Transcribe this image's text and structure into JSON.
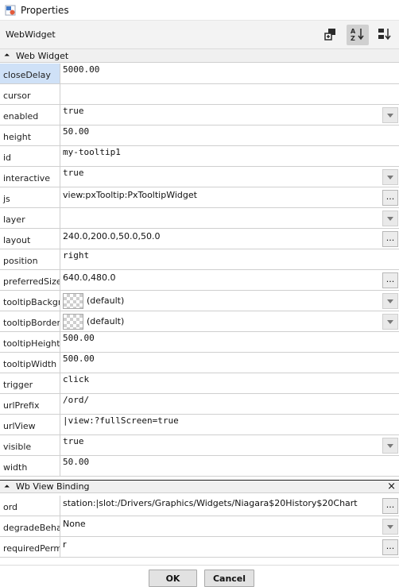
{
  "window": {
    "title": "Properties"
  },
  "toolbar": {
    "type_label": "WebWidget",
    "tools": [
      "add-slot-icon",
      "sort-az-icon",
      "sort-order-icon"
    ]
  },
  "sections": [
    {
      "title": "Web Widget",
      "rows": [
        {
          "name": "closeDelay",
          "value": "5000.00",
          "font": "mono",
          "control": "none",
          "selected": true
        },
        {
          "name": "cursor",
          "value": "",
          "font": "mono",
          "control": "none"
        },
        {
          "name": "enabled",
          "value": "true",
          "font": "mono",
          "control": "dropdown"
        },
        {
          "name": "height",
          "value": "50.00",
          "font": "mono",
          "control": "none"
        },
        {
          "name": "id",
          "value": "my-tooltip1",
          "font": "mono",
          "control": "none"
        },
        {
          "name": "interactive",
          "value": "true",
          "font": "mono",
          "control": "dropdown"
        },
        {
          "name": "js",
          "value": "view:pxTooltip:PxTooltipWidget",
          "font": "sans",
          "control": "ellipsis"
        },
        {
          "name": "layer",
          "value": "",
          "font": "mono",
          "control": "dropdown"
        },
        {
          "name": "layout",
          "value": "240.0,200.0,50.0,50.0",
          "font": "sans",
          "control": "ellipsis"
        },
        {
          "name": "position",
          "value": "right",
          "font": "mono",
          "control": "none"
        },
        {
          "name": "preferredSize",
          "value": "640.0,480.0",
          "font": "sans",
          "control": "ellipsis"
        },
        {
          "name": "tooltipBackground",
          "value": "(default)",
          "font": "sans",
          "control": "dropdown",
          "swatch": true
        },
        {
          "name": "tooltipBorder",
          "value": "(default)",
          "font": "sans",
          "control": "dropdown",
          "swatch": true
        },
        {
          "name": "tooltipHeight",
          "value": "500.00",
          "font": "mono",
          "control": "none"
        },
        {
          "name": "tooltipWidth",
          "value": "500.00",
          "font": "mono",
          "control": "none"
        },
        {
          "name": "trigger",
          "value": "click",
          "font": "mono",
          "control": "none"
        },
        {
          "name": "urlPrefix",
          "value": "/ord/",
          "font": "mono",
          "control": "none"
        },
        {
          "name": "urlView",
          "value": "|view:?fullScreen=true",
          "font": "mono",
          "control": "none"
        },
        {
          "name": "visible",
          "value": "true",
          "font": "mono",
          "control": "dropdown"
        },
        {
          "name": "width",
          "value": "50.00",
          "font": "mono",
          "control": "none"
        }
      ]
    },
    {
      "title": "Wb View Binding",
      "rows": [
        {
          "name": "ord",
          "value": "station:|slot:/Drivers/Graphics/Widgets/Niagara$20History$20Chart",
          "font": "sans",
          "control": "ellipsis"
        },
        {
          "name": "degradeBehavior",
          "value": "None",
          "font": "sans",
          "control": "dropdown"
        },
        {
          "name": "requiredPermissions",
          "value": "r",
          "font": "sans",
          "control": "ellipsis"
        }
      ]
    }
  ],
  "buttons": {
    "ok": "OK",
    "cancel": "Cancel"
  },
  "ui": {
    "ellipsis": "...",
    "close": "×",
    "collapse_glyph": "⏶"
  },
  "colors": {
    "selected_row": "#cfe1f7",
    "grid_line": "#cfcfcf",
    "header_bg": "#f0f0f0"
  }
}
